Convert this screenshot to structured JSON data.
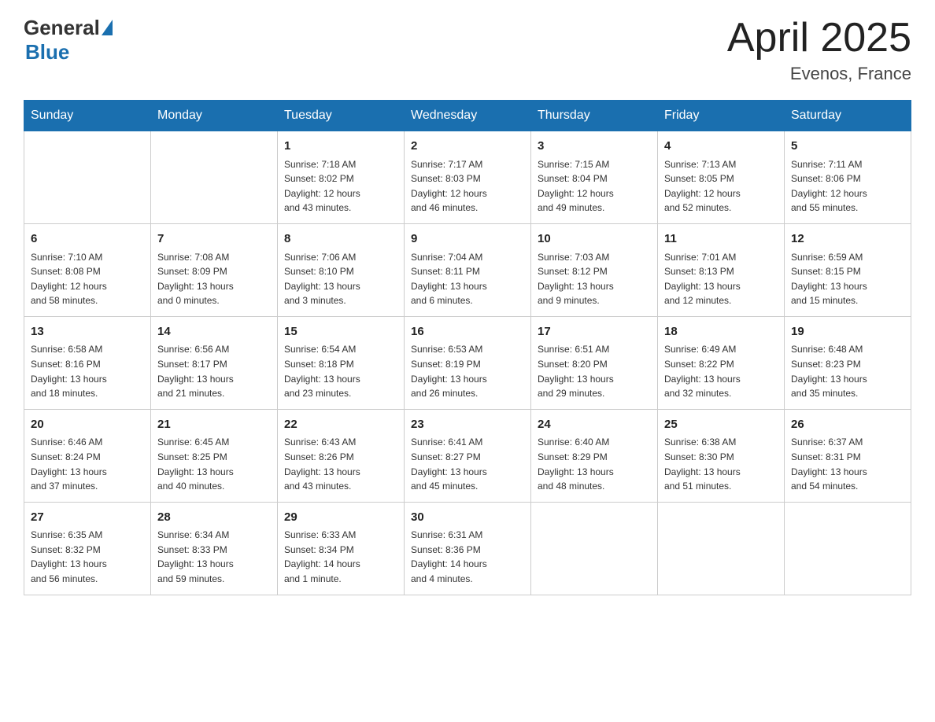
{
  "logo": {
    "general": "General",
    "blue": "Blue"
  },
  "title": "April 2025",
  "location": "Evenos, France",
  "days_of_week": [
    "Sunday",
    "Monday",
    "Tuesday",
    "Wednesday",
    "Thursday",
    "Friday",
    "Saturday"
  ],
  "weeks": [
    [
      {
        "day": "",
        "info": ""
      },
      {
        "day": "",
        "info": ""
      },
      {
        "day": "1",
        "info": "Sunrise: 7:18 AM\nSunset: 8:02 PM\nDaylight: 12 hours\nand 43 minutes."
      },
      {
        "day": "2",
        "info": "Sunrise: 7:17 AM\nSunset: 8:03 PM\nDaylight: 12 hours\nand 46 minutes."
      },
      {
        "day": "3",
        "info": "Sunrise: 7:15 AM\nSunset: 8:04 PM\nDaylight: 12 hours\nand 49 minutes."
      },
      {
        "day": "4",
        "info": "Sunrise: 7:13 AM\nSunset: 8:05 PM\nDaylight: 12 hours\nand 52 minutes."
      },
      {
        "day": "5",
        "info": "Sunrise: 7:11 AM\nSunset: 8:06 PM\nDaylight: 12 hours\nand 55 minutes."
      }
    ],
    [
      {
        "day": "6",
        "info": "Sunrise: 7:10 AM\nSunset: 8:08 PM\nDaylight: 12 hours\nand 58 minutes."
      },
      {
        "day": "7",
        "info": "Sunrise: 7:08 AM\nSunset: 8:09 PM\nDaylight: 13 hours\nand 0 minutes."
      },
      {
        "day": "8",
        "info": "Sunrise: 7:06 AM\nSunset: 8:10 PM\nDaylight: 13 hours\nand 3 minutes."
      },
      {
        "day": "9",
        "info": "Sunrise: 7:04 AM\nSunset: 8:11 PM\nDaylight: 13 hours\nand 6 minutes."
      },
      {
        "day": "10",
        "info": "Sunrise: 7:03 AM\nSunset: 8:12 PM\nDaylight: 13 hours\nand 9 minutes."
      },
      {
        "day": "11",
        "info": "Sunrise: 7:01 AM\nSunset: 8:13 PM\nDaylight: 13 hours\nand 12 minutes."
      },
      {
        "day": "12",
        "info": "Sunrise: 6:59 AM\nSunset: 8:15 PM\nDaylight: 13 hours\nand 15 minutes."
      }
    ],
    [
      {
        "day": "13",
        "info": "Sunrise: 6:58 AM\nSunset: 8:16 PM\nDaylight: 13 hours\nand 18 minutes."
      },
      {
        "day": "14",
        "info": "Sunrise: 6:56 AM\nSunset: 8:17 PM\nDaylight: 13 hours\nand 21 minutes."
      },
      {
        "day": "15",
        "info": "Sunrise: 6:54 AM\nSunset: 8:18 PM\nDaylight: 13 hours\nand 23 minutes."
      },
      {
        "day": "16",
        "info": "Sunrise: 6:53 AM\nSunset: 8:19 PM\nDaylight: 13 hours\nand 26 minutes."
      },
      {
        "day": "17",
        "info": "Sunrise: 6:51 AM\nSunset: 8:20 PM\nDaylight: 13 hours\nand 29 minutes."
      },
      {
        "day": "18",
        "info": "Sunrise: 6:49 AM\nSunset: 8:22 PM\nDaylight: 13 hours\nand 32 minutes."
      },
      {
        "day": "19",
        "info": "Sunrise: 6:48 AM\nSunset: 8:23 PM\nDaylight: 13 hours\nand 35 minutes."
      }
    ],
    [
      {
        "day": "20",
        "info": "Sunrise: 6:46 AM\nSunset: 8:24 PM\nDaylight: 13 hours\nand 37 minutes."
      },
      {
        "day": "21",
        "info": "Sunrise: 6:45 AM\nSunset: 8:25 PM\nDaylight: 13 hours\nand 40 minutes."
      },
      {
        "day": "22",
        "info": "Sunrise: 6:43 AM\nSunset: 8:26 PM\nDaylight: 13 hours\nand 43 minutes."
      },
      {
        "day": "23",
        "info": "Sunrise: 6:41 AM\nSunset: 8:27 PM\nDaylight: 13 hours\nand 45 minutes."
      },
      {
        "day": "24",
        "info": "Sunrise: 6:40 AM\nSunset: 8:29 PM\nDaylight: 13 hours\nand 48 minutes."
      },
      {
        "day": "25",
        "info": "Sunrise: 6:38 AM\nSunset: 8:30 PM\nDaylight: 13 hours\nand 51 minutes."
      },
      {
        "day": "26",
        "info": "Sunrise: 6:37 AM\nSunset: 8:31 PM\nDaylight: 13 hours\nand 54 minutes."
      }
    ],
    [
      {
        "day": "27",
        "info": "Sunrise: 6:35 AM\nSunset: 8:32 PM\nDaylight: 13 hours\nand 56 minutes."
      },
      {
        "day": "28",
        "info": "Sunrise: 6:34 AM\nSunset: 8:33 PM\nDaylight: 13 hours\nand 59 minutes."
      },
      {
        "day": "29",
        "info": "Sunrise: 6:33 AM\nSunset: 8:34 PM\nDaylight: 14 hours\nand 1 minute."
      },
      {
        "day": "30",
        "info": "Sunrise: 6:31 AM\nSunset: 8:36 PM\nDaylight: 14 hours\nand 4 minutes."
      },
      {
        "day": "",
        "info": ""
      },
      {
        "day": "",
        "info": ""
      },
      {
        "day": "",
        "info": ""
      }
    ]
  ]
}
